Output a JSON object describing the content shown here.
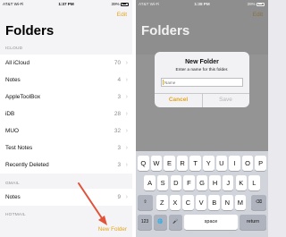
{
  "left": {
    "status": {
      "carrier": "AT&T Wi-Fi",
      "time": "1:37 PM",
      "battery": "39%"
    },
    "edit_label": "Edit",
    "title": "Folders",
    "sections": [
      {
        "header": "ICLOUD",
        "rows": [
          {
            "name": "All iCloud",
            "count": "70"
          },
          {
            "name": "Notes",
            "count": "4"
          },
          {
            "name": "AppleToolBox",
            "count": "3"
          },
          {
            "name": "iDB",
            "count": "28"
          },
          {
            "name": "MUO",
            "count": "32"
          },
          {
            "name": "Test Notes",
            "count": "3"
          },
          {
            "name": "Recently Deleted",
            "count": "3"
          }
        ]
      },
      {
        "header": "GMAIL",
        "rows": [
          {
            "name": "Notes",
            "count": "9"
          }
        ]
      },
      {
        "header": "HOTMAIL",
        "rows": []
      }
    ],
    "new_folder_label": "New Folder",
    "accent": "#e4a41c",
    "annotation_arrow_color": "#e0533a"
  },
  "right": {
    "status": {
      "carrier": "AT&T Wi-Fi",
      "time": "1:38 PM",
      "battery": "39%"
    },
    "edit_label": "Edit",
    "title": "Folders",
    "alert": {
      "title": "New Folder",
      "message": "Enter a name for this folder.",
      "input_placeholder": "Name",
      "cancel_label": "Cancel",
      "save_label": "Save"
    },
    "keyboard": {
      "row1": [
        "Q",
        "W",
        "E",
        "R",
        "T",
        "Y",
        "U",
        "I",
        "O",
        "P"
      ],
      "row2": [
        "A",
        "S",
        "D",
        "F",
        "G",
        "H",
        "J",
        "K",
        "L"
      ],
      "row3": [
        "Z",
        "X",
        "C",
        "V",
        "B",
        "N",
        "M"
      ],
      "shift_icon": "shift-icon",
      "delete_icon": "backspace-icon",
      "numbers_label": "123",
      "globe_icon": "globe-icon",
      "mic_icon": "microphone-icon",
      "space_label": "space",
      "return_label": "return"
    }
  }
}
